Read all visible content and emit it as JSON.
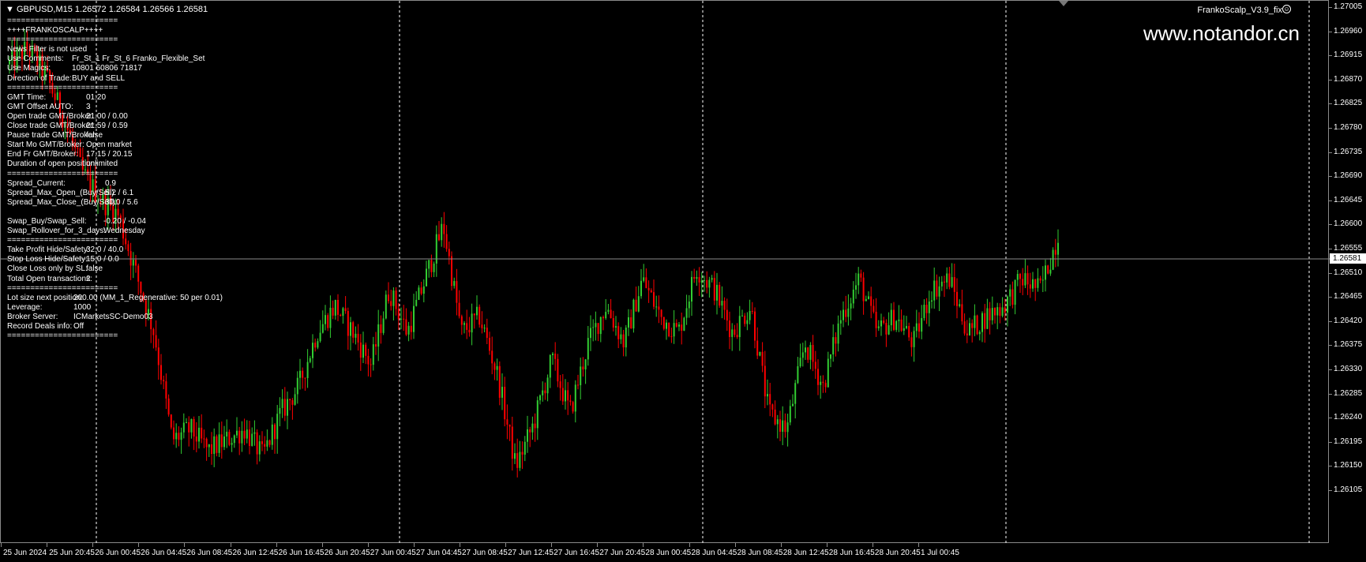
{
  "header": {
    "symbol_line": "▼ GBPUSD,M15  1.26572 1.26584 1.26566 1.26581",
    "ea_name": "FrankoScalp_V3.9_fix",
    "ea_icon": "smiley-icon",
    "watermark": "www.notandor.cn"
  },
  "info_panel": [
    {
      "label": "========================",
      "value": ""
    },
    {
      "label": "++++FRANKOSCALP++++",
      "value": ""
    },
    {
      "label": "========================",
      "value": ""
    },
    {
      "label": "News Filter is not used",
      "value": ""
    },
    {
      "label": "Use Comments:",
      "value": "Fr_St_1     Fr_St_6     Franko_Flexible_Set"
    },
    {
      "label": "Use Magics:",
      "value": "10801        60806        71817"
    },
    {
      "label": "Direction of Trade:",
      "value": "BUY and SELL"
    },
    {
      "label": "========================",
      "value": ""
    },
    {
      "label": "GMT Time:",
      "value": "01:20"
    },
    {
      "label": "GMT Offset AUTO:",
      "value": "3"
    },
    {
      "label": "Open trade GMT/Broker:",
      "value": "21.00 / 0.00"
    },
    {
      "label": "Close trade GMT/Broker:",
      "value": "21.59 / 0.59"
    },
    {
      "label": "Pause trade GMT/Broker:",
      "value": "false"
    },
    {
      "label": "Start Mo GMT/Broker:",
      "value": "Open market"
    },
    {
      "label": "End Fr GMT/Broker:",
      "value": "17.15 / 20.15"
    },
    {
      "label": "Duration of open position:",
      "value": "unlimited"
    },
    {
      "label": "========================",
      "value": ""
    },
    {
      "label": "Spread_Current:",
      "value": "0.9"
    },
    {
      "label": "Spread_Max_Open_(Buy/Sell):",
      "value": "5.2 / 6.1"
    },
    {
      "label": "Spread_Max_Close_(Buy/Sell):",
      "value": "30.0 / 5.6"
    },
    {
      "label": "",
      "value": ""
    },
    {
      "label": "Swap_Buy/Swap_Sell:",
      "value": "-0.20 / -0.04"
    },
    {
      "label": "Swap_Rollover_for_3_days:",
      "value": "Wednesday"
    },
    {
      "label": "========================",
      "value": ""
    },
    {
      "label": "Take Profit Hide/Safety:",
      "value": "32.0 / 40.0"
    },
    {
      "label": "Stop Loss  Hide/Safety:",
      "value": "15.0 / 0.0"
    },
    {
      "label": "Close Loss only by SL:",
      "value": "false"
    },
    {
      "label": "Total Open transactions:",
      "value": "2"
    },
    {
      "label": "========================",
      "value": ""
    },
    {
      "label": "Lot size next position:",
      "value": "200.00 (MM_1_Regenerative: 50 per 0.01)"
    },
    {
      "label": "Leverage:",
      "value": "1000"
    },
    {
      "label": "Broker Server:",
      "value": "ICMarketsSC-Demo03"
    },
    {
      "label": "Record Deals info:",
      "value": "Off"
    },
    {
      "label": "========================",
      "value": ""
    }
  ],
  "price_axis": [
    "1.27005",
    "1.26960",
    "1.26915",
    "1.26870",
    "1.26825",
    "1.26780",
    "1.26735",
    "1.26690",
    "1.26645",
    "1.26600",
    "1.26555",
    "1.26510",
    "1.26465",
    "1.26420",
    "1.26375",
    "1.26330",
    "1.26285",
    "1.26240",
    "1.26195",
    "1.26150",
    "1.26105"
  ],
  "current_price": "1.26581",
  "time_axis": [
    "25 Jun 2024",
    "25 Jun 20:45",
    "26 Jun 00:45",
    "26 Jun 04:45",
    "26 Jun 08:45",
    "26 Jun 12:45",
    "26 Jun 16:45",
    "26 Jun 20:45",
    "27 Jun 00:45",
    "27 Jun 04:45",
    "27 Jun 08:45",
    "27 Jun 12:45",
    "27 Jun 16:45",
    "27 Jun 20:45",
    "28 Jun 00:45",
    "28 Jun 04:45",
    "28 Jun 08:45",
    "28 Jun 12:45",
    "28 Jun 16:45",
    "28 Jun 20:45",
    "1 Jul 00:45"
  ],
  "colors": {
    "bull": "#32cd32",
    "bear": "#ff0000",
    "background": "#000000",
    "grid": "#ffffff",
    "text": "#ffffff"
  },
  "chart_data": {
    "type": "candlestick",
    "symbol": "GBPUSD",
    "timeframe": "M15",
    "ylim": [
      1.26105,
      1.27005
    ],
    "close_path": [
      1.269,
      1.2693,
      1.2688,
      1.268,
      1.267,
      1.2665,
      1.2662,
      1.2651,
      1.264,
      1.262,
      1.2622,
      1.2618,
      1.262,
      1.2622,
      1.2617,
      1.2625,
      1.263,
      1.264,
      1.2645,
      1.264,
      1.2634,
      1.2648,
      1.264,
      1.265,
      1.266,
      1.264,
      1.2643,
      1.2632,
      1.2615,
      1.2623,
      1.2635,
      1.2625,
      1.2638,
      1.2645,
      1.2638,
      1.265,
      1.2643,
      1.264,
      1.2652,
      1.2648,
      1.264,
      1.2645,
      1.2625,
      1.2622,
      1.2638,
      1.263,
      1.2643,
      1.265,
      1.264,
      1.2643,
      1.2638,
      1.2648,
      1.265,
      1.264,
      1.2643,
      1.2645,
      1.265,
      1.2648,
      1.2658
    ]
  }
}
